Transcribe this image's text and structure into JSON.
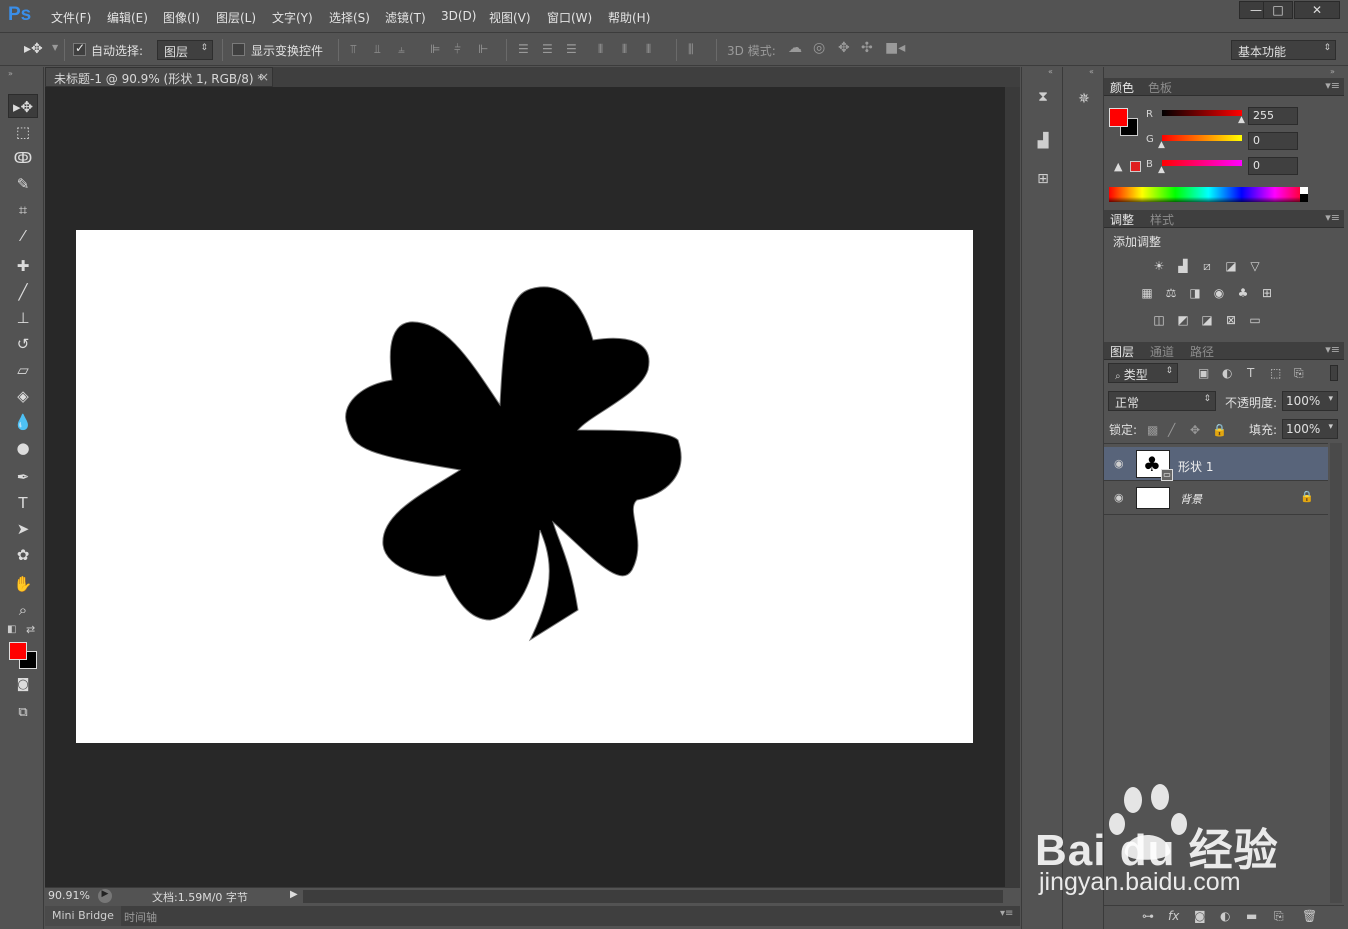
{
  "app": {
    "logo": "Ps"
  },
  "menu": [
    "文件(F)",
    "编辑(E)",
    "图像(I)",
    "图层(L)",
    "文字(Y)",
    "选择(S)",
    "滤镜(T)",
    "3D(D)",
    "视图(V)",
    "窗口(W)",
    "帮助(H)"
  ],
  "window_buttons": [
    "—",
    "□",
    "✕"
  ],
  "options": {
    "auto_select_label": "自动选择:",
    "auto_select_value": "图层",
    "show_transform_label": "显示变换控件",
    "mode_3d_label": "3D 模式:",
    "workspace": "基本功能"
  },
  "document": {
    "tab_title": "未标题-1 @ 90.9% (形状 1, RGB/8) *",
    "close": "×",
    "zoom": "90.91%",
    "doc_info": "文档:1.59M/0 字节"
  },
  "bottom_tabs": [
    "Mini Bridge",
    "时间轴"
  ],
  "color_panel": {
    "tabs": [
      "颜色",
      "色板"
    ],
    "r_label": "R",
    "g_label": "G",
    "b_label": "B",
    "r": "255",
    "g": "0",
    "b": "0",
    "foreground": "#ff0000",
    "background": "#000000"
  },
  "adjust_panel": {
    "tabs": [
      "调整",
      "样式"
    ],
    "title": "添加调整"
  },
  "layers_panel": {
    "tabs": [
      "图层",
      "通道",
      "路径"
    ],
    "filter": "类型",
    "blend_mode": "正常",
    "opacity_label": "不透明度:",
    "opacity": "100%",
    "lock_label": "锁定:",
    "fill_label": "填充:",
    "fill": "100%",
    "layers": [
      {
        "name": "形状 1",
        "selected": true
      },
      {
        "name": "背景",
        "selected": false
      }
    ],
    "footer_icons": [
      "link-icon",
      "fx-icon",
      "mask-icon",
      "adjustment-icon",
      "folder-icon",
      "new-layer-icon",
      "trash-icon"
    ]
  },
  "watermark": {
    "brand": "Bai du 经验",
    "url": "jingyan.baidu.com"
  }
}
